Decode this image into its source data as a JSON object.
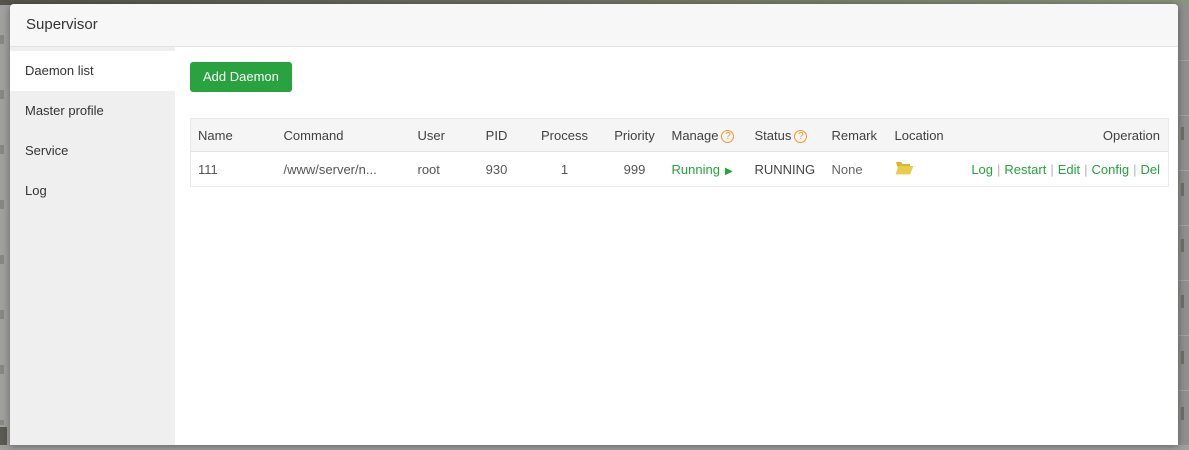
{
  "window": {
    "title": "Supervisor"
  },
  "sidebar": {
    "items": [
      {
        "label": "Daemon list",
        "active": true
      },
      {
        "label": "Master profile",
        "active": false
      },
      {
        "label": "Service",
        "active": false
      },
      {
        "label": "Log",
        "active": false
      }
    ]
  },
  "toolbar": {
    "add_daemon_label": "Add Daemon"
  },
  "table": {
    "columns": {
      "name": "Name",
      "command": "Command",
      "user": "User",
      "pid": "PID",
      "process": "Process",
      "priority": "Priority",
      "manage": "Manage",
      "status": "Status",
      "remark": "Remark",
      "location": "Location",
      "operation": "Operation"
    },
    "op_separator": "|",
    "rows": [
      {
        "name": "111",
        "command": "/www/server/n...",
        "user": "root",
        "pid": "930",
        "process": "1",
        "priority": "999",
        "manage": "Running",
        "status": "RUNNING",
        "remark": "None",
        "location_icon": "open-folder",
        "operations": [
          "Log",
          "Restart",
          "Edit",
          "Config",
          "Del"
        ]
      }
    ]
  },
  "icons": {
    "help": "?",
    "play": "▶"
  },
  "colors": {
    "button_green": "#29a340",
    "link_green": "#23a33b",
    "help_orange": "#ff9527",
    "folder_yellow": "#e9cd4a",
    "sidebar_gray": "#efefef",
    "header_gray": "#f5f5f5"
  }
}
